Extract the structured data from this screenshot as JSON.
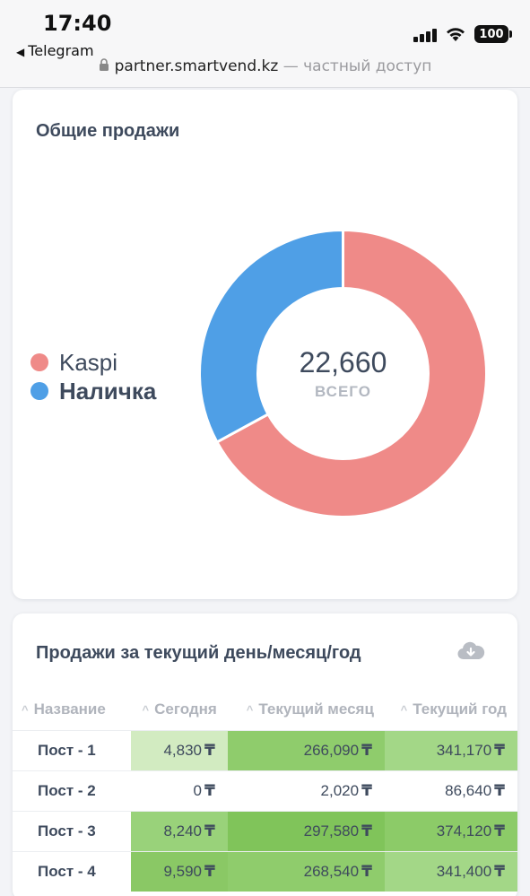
{
  "status_bar": {
    "time": "17:40",
    "back_app": "Telegram",
    "battery": "100",
    "signal_icon": "signal-bars-icon",
    "wifi_icon": "wifi-icon"
  },
  "url_bar": {
    "domain": "partner.smartvend.kz",
    "note": "— частный доступ"
  },
  "sales_card": {
    "title": "Общие продажи",
    "legend": [
      {
        "label": "Kaspi",
        "color": "#ef8a88"
      },
      {
        "label": "Наличка",
        "color": "#4f9fe6"
      }
    ],
    "total": "22,660",
    "total_label": "ВСЕГО"
  },
  "chart_data": {
    "type": "pie",
    "categories": [
      "Kaspi",
      "Наличка"
    ],
    "values": [
      15200,
      7460
    ],
    "colors": [
      "#ef8a88",
      "#4f9fe6"
    ],
    "donut": true,
    "center_text": "22,660",
    "center_label": "ВСЕГО",
    "legend_position": "left"
  },
  "table_card": {
    "title": "Продажи за текущий день/месяц/год",
    "download_icon": "cloud-download-icon",
    "columns": [
      "Название",
      "Сегодня",
      "Текущий месяц",
      "Текущий год"
    ],
    "currency": "₸",
    "rows": [
      {
        "name": "Пост - 1",
        "today": "4,830",
        "month": "266,090",
        "year": "341,170",
        "today_bg": "#d2ebc1",
        "month_bg": "#8fcc6c",
        "year_bg": "#a3d787"
      },
      {
        "name": "Пост - 2",
        "today": "0",
        "month": "2,020",
        "year": "86,640",
        "today_bg": "#ffffff",
        "month_bg": "#ffffff",
        "year_bg": "#ffffff"
      },
      {
        "name": "Пост - 3",
        "today": "8,240",
        "month": "297,580",
        "year": "374,120",
        "today_bg": "#99d27a",
        "month_bg": "#80c45a",
        "year_bg": "#8ccb68"
      },
      {
        "name": "Пост - 4",
        "today": "9,590",
        "month": "268,540",
        "year": "341,400",
        "today_bg": "#8ac865",
        "month_bg": "#8fcc6c",
        "year_bg": "#a3d787"
      }
    ]
  }
}
